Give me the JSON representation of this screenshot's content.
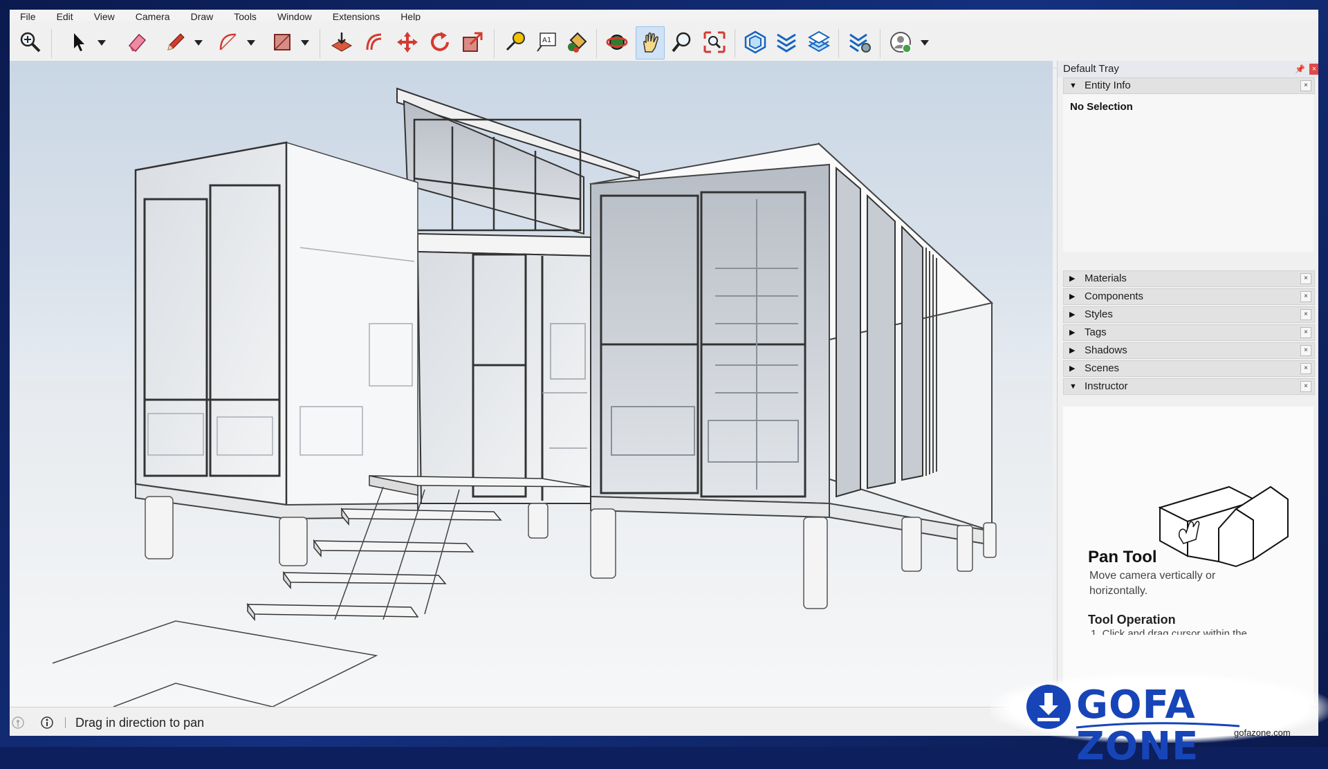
{
  "app": {
    "accent": "#1a73e8",
    "frame_color": "#0d1f5c"
  },
  "menu": [
    "File",
    "Edit",
    "View",
    "Camera",
    "Draw",
    "Tools",
    "Window",
    "Extensions",
    "Help"
  ],
  "toolbar": {
    "tools": [
      "zoom-icon",
      "select-icon",
      "eraser-icon",
      "pencil-icon",
      "arc-icon",
      "rectangle-icon",
      "push-pull-icon",
      "offset-icon",
      "move-icon",
      "rotate-icon",
      "scale-icon",
      "tape-measure-icon",
      "text-icon",
      "paint-bucket-icon",
      "orbit-icon",
      "pan-icon",
      "zoom-magnifier-icon",
      "zoom-extents-icon",
      "3d-warehouse-icon",
      "extension-warehouse-icon",
      "layout-icon",
      "extension-manager-icon",
      "account-icon"
    ],
    "active_tool": "pan-icon"
  },
  "tray": {
    "title": "Default Tray",
    "close_symbol": "×",
    "entity_info": {
      "label": "Entity Info",
      "state": "No Selection"
    },
    "panels": [
      "Materials",
      "Components",
      "Styles",
      "Tags",
      "Shadows",
      "Scenes"
    ],
    "instructor": {
      "label": "Instructor",
      "tool_name": "Pan Tool",
      "description": "Move camera vertically or horizontally.",
      "operation_heading": "Tool Operation",
      "step": "1. Click and drag cursor within the"
    }
  },
  "status": {
    "message": "Drag in direction to pan"
  },
  "watermark": {
    "text": "GOFA ZONE",
    "url": "gofazone.com",
    "color": "#1745b8"
  }
}
